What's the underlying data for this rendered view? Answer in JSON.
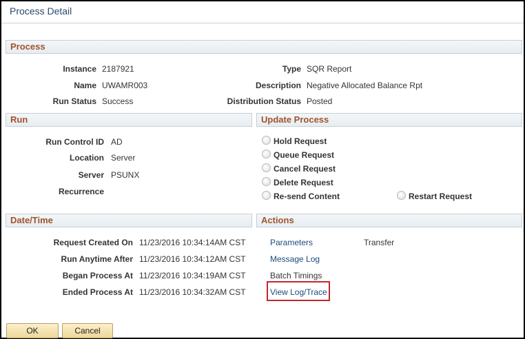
{
  "window": {
    "title": "Process Detail"
  },
  "sections": {
    "process": "Process",
    "run": "Run",
    "update": "Update Process",
    "datetime": "Date/Time",
    "actions": "Actions"
  },
  "process": {
    "instance_label": "Instance",
    "instance": "2187921",
    "name_label": "Name",
    "name": "UWAMR003",
    "run_status_label": "Run Status",
    "run_status": "Success",
    "type_label": "Type",
    "type": "SQR Report",
    "description_label": "Description",
    "description": "Negative Allocated Balance Rpt",
    "dist_status_label": "Distribution Status",
    "dist_status": "Posted"
  },
  "run": {
    "run_control_label": "Run Control ID",
    "run_control": "AD",
    "location_label": "Location",
    "location": "Server",
    "server_label": "Server",
    "server": "PSUNX",
    "recurrence_label": "Recurrence",
    "recurrence": ""
  },
  "update": {
    "hold": "Hold Request",
    "queue": "Queue Request",
    "cancel": "Cancel Request",
    "delete": "Delete Request",
    "resend": "Re-send Content",
    "restart": "Restart Request"
  },
  "datetime": {
    "created_label": "Request Created On",
    "created": "11/23/2016 10:34:14AM CST",
    "anytime_label": "Run Anytime After",
    "anytime": "11/23/2016 10:34:12AM CST",
    "began_label": "Began Process At",
    "began": "11/23/2016 10:34:19AM CST",
    "ended_label": "Ended Process At",
    "ended": "11/23/2016 10:34:32AM CST"
  },
  "actions": {
    "parameters": "Parameters",
    "transfer": "Transfer",
    "message_log": "Message Log",
    "batch_timings": "Batch Timings",
    "view_log": "View Log/Trace"
  },
  "buttons": {
    "ok": "OK",
    "cancel": "Cancel"
  },
  "colors": {
    "highlight": "#c0272d",
    "section_title": "#a0522d",
    "link": "#1e4a7a"
  }
}
